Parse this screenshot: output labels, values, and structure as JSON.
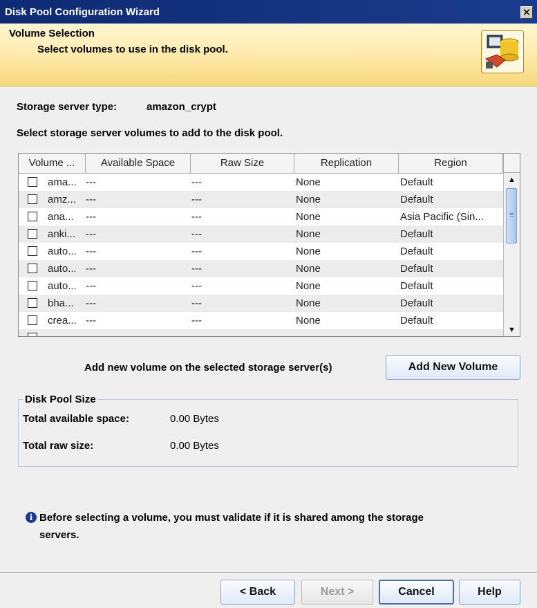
{
  "window": {
    "title": "Disk Pool Configuration Wizard",
    "close": "✕"
  },
  "header": {
    "title": "Volume Selection",
    "subtitle": "Select volumes to use in the disk pool."
  },
  "storage_type": {
    "label": "Storage server type:",
    "value": "amazon_crypt"
  },
  "instruction": "Select storage server volumes to add to the disk pool.",
  "table": {
    "columns": [
      "Volume ...",
      "Available Space",
      "Raw Size",
      "Replication",
      "Region"
    ],
    "rows": [
      {
        "volume": "ama...",
        "available": "---",
        "raw": "---",
        "replication": "None",
        "region": "Default"
      },
      {
        "volume": "amz...",
        "available": "---",
        "raw": "---",
        "replication": "None",
        "region": "Default"
      },
      {
        "volume": "ana...",
        "available": "---",
        "raw": "---",
        "replication": "None",
        "region": "Asia Pacific (Sin..."
      },
      {
        "volume": "anki...",
        "available": "---",
        "raw": "---",
        "replication": "None",
        "region": "Default"
      },
      {
        "volume": "auto...",
        "available": "---",
        "raw": "---",
        "replication": "None",
        "region": "Default"
      },
      {
        "volume": "auto...",
        "available": "---",
        "raw": "---",
        "replication": "None",
        "region": "Default"
      },
      {
        "volume": "auto...",
        "available": "---",
        "raw": "---",
        "replication": "None",
        "region": "Default"
      },
      {
        "volume": "bha...",
        "available": "---",
        "raw": "---",
        "replication": "None",
        "region": "Default"
      },
      {
        "volume": "crea...",
        "available": "---",
        "raw": "---",
        "replication": "None",
        "region": "Default"
      }
    ]
  },
  "add_volume": {
    "label": "Add new volume on the selected storage server(s)",
    "button": "Add New Volume"
  },
  "disk_pool": {
    "legend": "Disk Pool Size",
    "available_label": "Total available space:",
    "available_value": "0.00 Bytes",
    "raw_label": "Total raw size:",
    "raw_value": "0.00 Bytes"
  },
  "info": {
    "line1": "Before selecting a volume, you must validate if it is shared among the storage",
    "line2": "servers."
  },
  "buttons": {
    "back": "< Back",
    "next": "Next >",
    "cancel": "Cancel",
    "help": "Help"
  }
}
